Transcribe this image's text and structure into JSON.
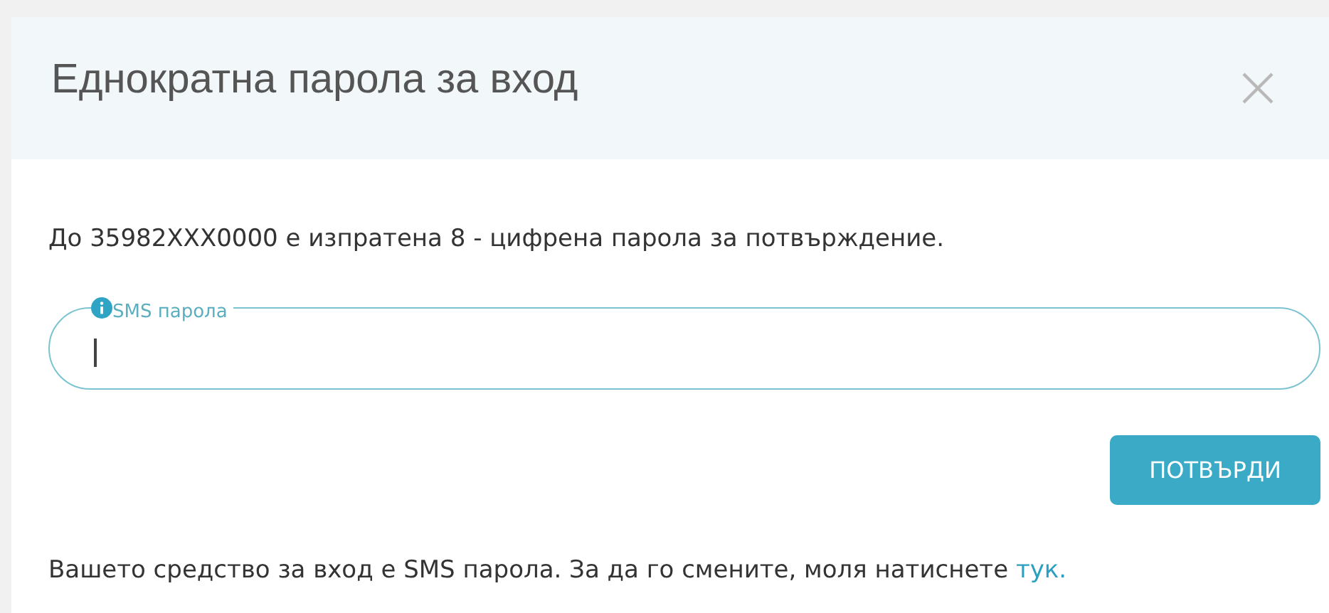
{
  "dialog": {
    "title": "Еднократна парола за вход",
    "message": "До 35982XXX0000 е изпратена 8 - цифрена парола за потвърждение.",
    "field": {
      "label": "SMS парола"
    },
    "button": "ПОТВЪРДИ",
    "footer": {
      "text": "Вашето средство за вход е SMS парола. За да го смените, моля натиснете ",
      "link": "тук."
    }
  }
}
